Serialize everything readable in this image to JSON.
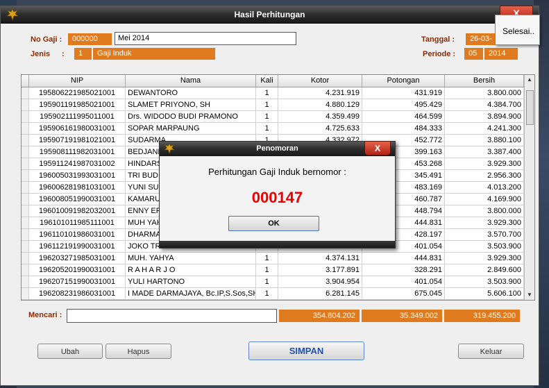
{
  "window": {
    "title": "Hasil Perhitungan",
    "close_label": "X"
  },
  "form": {
    "no_gaji_label": "No Gaji :",
    "no_gaji_value": "000000",
    "month_value": "Mei 2014",
    "jenis_label": "Jenis",
    "jenis_colon": ":",
    "jenis_code": "1",
    "jenis_name": "Gaji Induk",
    "tanggal_label": "Tanggal :",
    "tanggal_value": "26-03-",
    "periode_label": "Periode :",
    "periode_month": "05",
    "periode_year": "2014"
  },
  "popup_menu": {
    "item": "Selesai.."
  },
  "table": {
    "columns": [
      "NIP",
      "Nama",
      "Kali",
      "Kotor",
      "Potongan",
      "Bersih"
    ],
    "rows": [
      [
        "195806221985021001",
        "DEWANTORO",
        "1",
        "4.231.919",
        "431.919",
        "3.800.000"
      ],
      [
        "195901191985021001",
        "SLAMET PRIYONO, SH",
        "1",
        "4.880.129",
        "495.429",
        "4.384.700"
      ],
      [
        "195902111995011001",
        "Drs. WIDODO BUDI PRAMONO",
        "1",
        "4.359.499",
        "464.599",
        "3.894.900"
      ],
      [
        "195906161980031001",
        "SOPAR MARPAUNG",
        "1",
        "4.725.633",
        "484.333",
        "4.241.300"
      ],
      [
        "195907191981021001",
        "SUDARMA",
        "1",
        "4.332.972",
        "452.772",
        "3.880.100"
      ],
      [
        "195908111982031001",
        "BEDJANI",
        "",
        "",
        "399.163",
        "3.387.400"
      ],
      [
        "195911241987031002",
        "HINDARS",
        "",
        "",
        "453.268",
        "3.929.300"
      ],
      [
        "196005031993031001",
        "TRI BUDIA",
        "",
        "",
        "345.491",
        "2.956.300"
      ],
      [
        "196006281981031001",
        "YUNI SUK",
        "",
        "",
        "483.169",
        "4.013.200"
      ],
      [
        "196008051990031001",
        "KAMARU",
        "",
        "",
        "460.787",
        "4.169.900"
      ],
      [
        "196010091982032001",
        "ENNY ER",
        "",
        "",
        "448.794",
        "3.800.000"
      ],
      [
        "196101011985111001",
        "MUH YAH",
        "",
        "",
        "444.831",
        "3.929.300"
      ],
      [
        "196110101986031001",
        "DHARMA",
        "",
        "",
        "428.197",
        "3.570.700"
      ],
      [
        "196112191990031001",
        "JOKO TR",
        "",
        "",
        "401.054",
        "3.503.900"
      ],
      [
        "196203271985031001",
        "MUH. YAHYA",
        "1",
        "4.374.131",
        "444.831",
        "3.929.300"
      ],
      [
        "196205201990031001",
        "R A H A R J O",
        "1",
        "3.177.891",
        "328.291",
        "2.849.600"
      ],
      [
        "196207151990031001",
        "YULI HARTONO",
        "1",
        "3.904.954",
        "401.054",
        "3.503.900"
      ],
      [
        "196208231986031001",
        "I MADE DARMAJAYA, Bc.IP,S.Sos,SH",
        "1",
        "6.281.145",
        "675.045",
        "5.606.100"
      ]
    ]
  },
  "search": {
    "label": "Mencari :",
    "value": ""
  },
  "totals": {
    "kotor": "354.804.202",
    "potongan": "35.349.002",
    "bersih": "319.455.200"
  },
  "buttons": {
    "ubah": "Ubah",
    "hapus": "Hapus",
    "simpan": "SIMPAN",
    "keluar": "Keluar"
  },
  "dialog": {
    "title": "Penomoran",
    "close_label": "X",
    "message": "Perhitungan Gaji Induk bernomor :",
    "number": "000147",
    "ok": "OK"
  }
}
